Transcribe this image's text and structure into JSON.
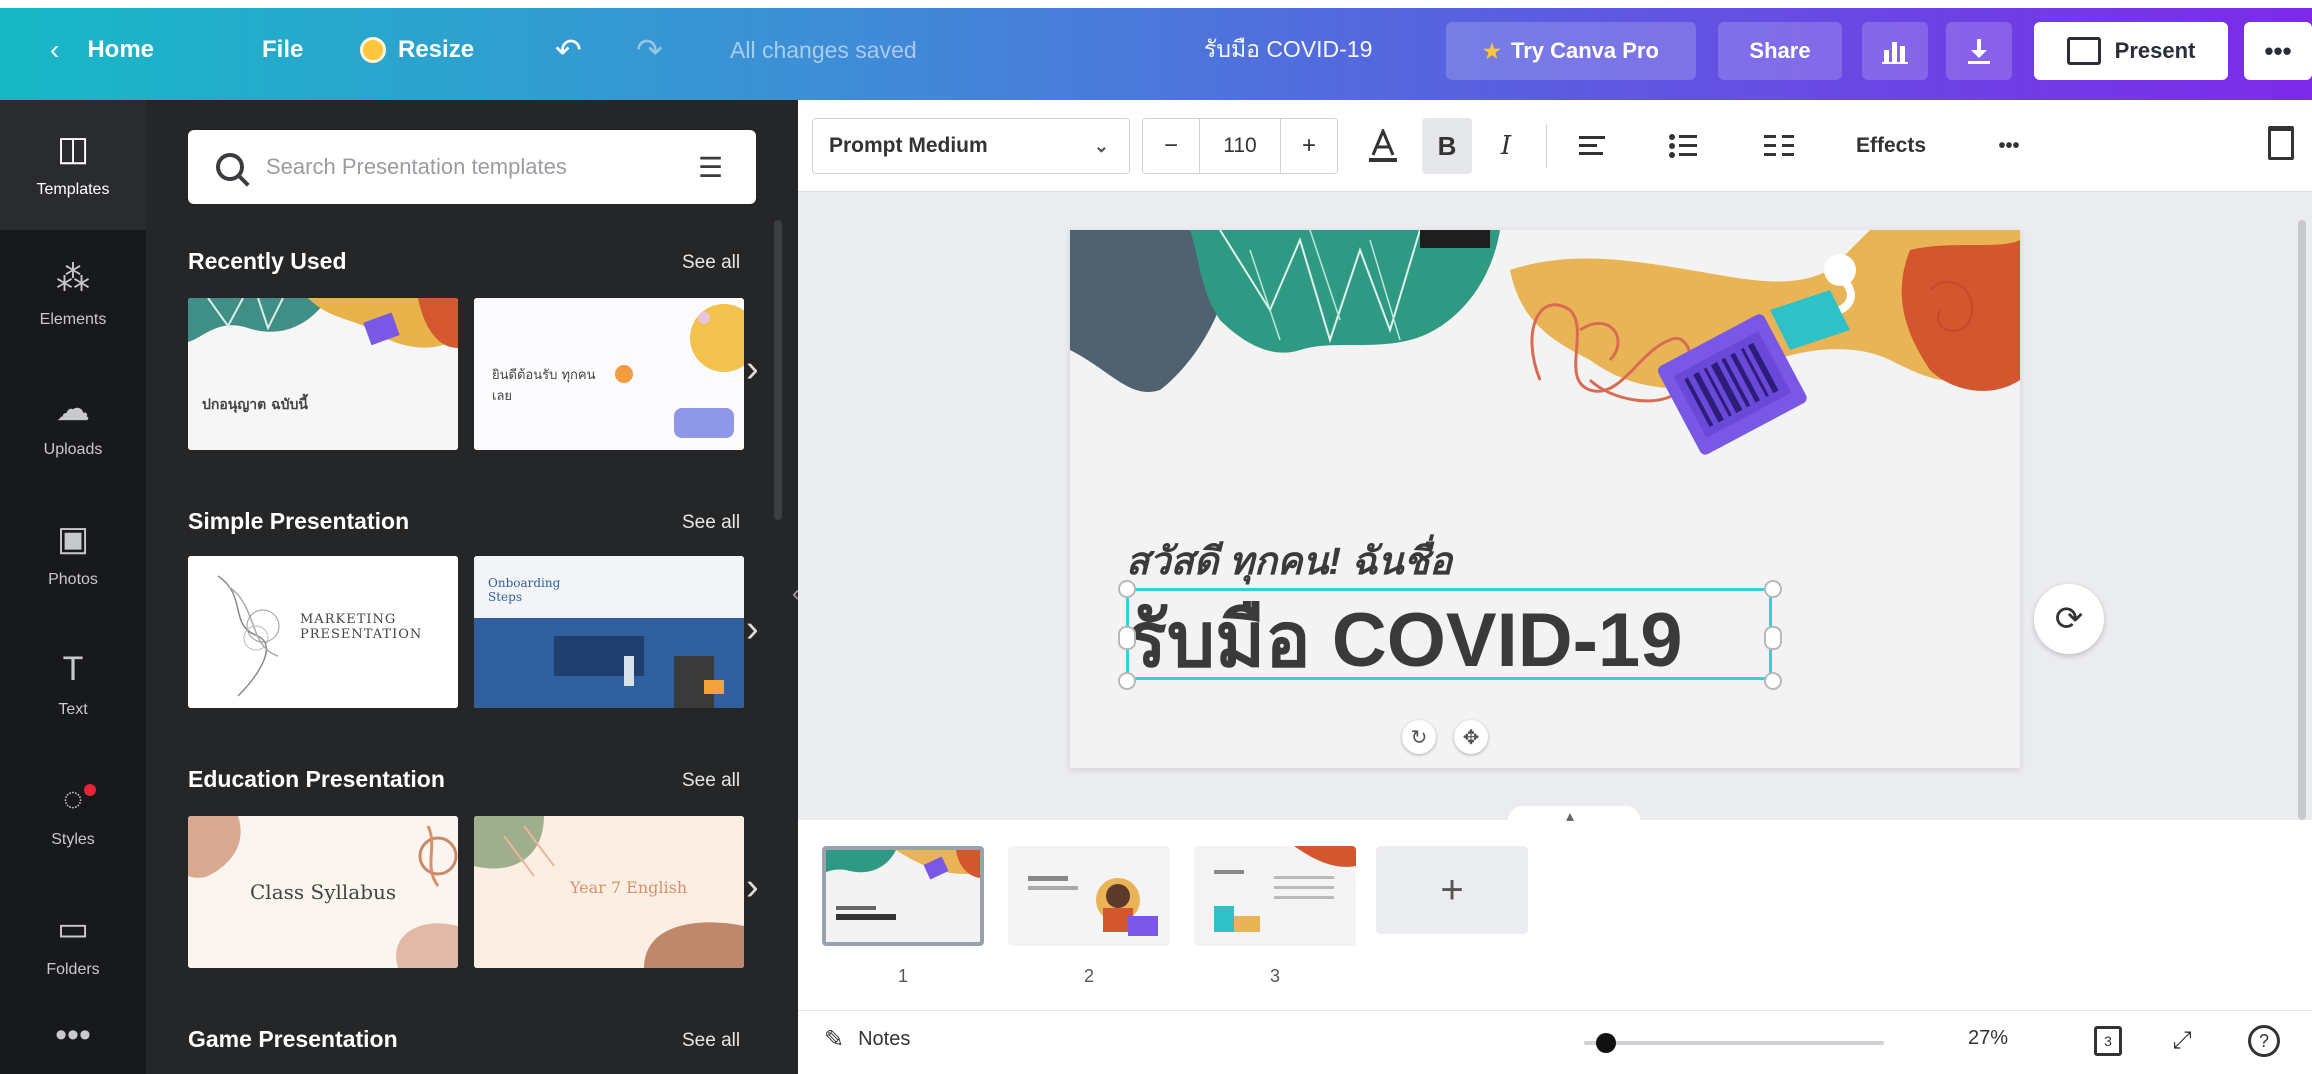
{
  "topbar": {
    "home_label": "Home",
    "file_label": "File",
    "resize_label": "Resize",
    "saved_status": "All changes saved",
    "document_title": "รับมือ COVID-19",
    "try_pro_label": "Try Canva Pro",
    "share_label": "Share",
    "present_label": "Present",
    "more_label": "•••"
  },
  "rail": {
    "items": [
      {
        "label": "Templates",
        "icon": "templates-icon",
        "glyph": "◫"
      },
      {
        "label": "Elements",
        "icon": "elements-icon",
        "glyph": "⁂"
      },
      {
        "label": "Uploads",
        "icon": "uploads-icon",
        "glyph": "☁"
      },
      {
        "label": "Photos",
        "icon": "photos-icon",
        "glyph": "▣"
      },
      {
        "label": "Text",
        "icon": "text-icon",
        "glyph": "T"
      },
      {
        "label": "Styles",
        "icon": "styles-icon",
        "glyph": "◌"
      },
      {
        "label": "Folders",
        "icon": "folders-icon",
        "glyph": "▭"
      },
      {
        "label": "More",
        "icon": "more-icon",
        "glyph": "•••"
      }
    ]
  },
  "panel": {
    "search_placeholder": "Search Presentation templates",
    "see_all": "See all",
    "sections": [
      {
        "title": "Recently Used",
        "thumbs": [
          {
            "text": "ปกอนุญาต ฉบับนี้"
          },
          {
            "text": "ยินดีต้อนรับ ทุกคนเลย"
          }
        ]
      },
      {
        "title": "Simple Presentation",
        "thumbs": [
          {
            "text": "MARKETING PRESENTATION"
          },
          {
            "text": "Onboarding Steps"
          }
        ]
      },
      {
        "title": "Education Presentation",
        "thumbs": [
          {
            "text": "Class Syllabus"
          },
          {
            "text": "Year 7 English"
          }
        ]
      },
      {
        "title": "Game Presentation"
      }
    ]
  },
  "toolbar": {
    "font_name": "Prompt Medium",
    "font_size": "110",
    "minus": "−",
    "plus": "+",
    "effects_label": "Effects",
    "more_label": "•••"
  },
  "slide": {
    "subtitle": "สวัสดี ทุกคน! ฉันชื่อ",
    "title": "รับมือ COVID-19"
  },
  "filmstrip": {
    "pages": [
      "1",
      "2",
      "3"
    ],
    "add_label": "+"
  },
  "bottombar": {
    "notes_label": "Notes",
    "zoom_percent": "27%",
    "zoom_level": 0.27,
    "page_count": "3"
  },
  "colors": {
    "accent_teal": "#17b9c6",
    "accent_purple": "#7d2ae8",
    "selection": "#2fd3d8",
    "notification": "#e5243b"
  }
}
